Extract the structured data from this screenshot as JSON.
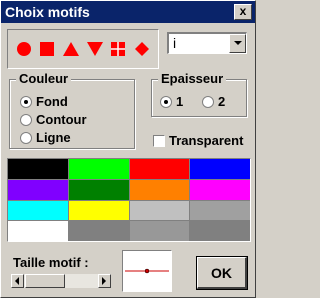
{
  "window": {
    "title": "Choix motifs",
    "close_label": "x"
  },
  "shapes": [
    {
      "name": "circle-shape-icon",
      "shape": "circle"
    },
    {
      "name": "square-shape-icon",
      "shape": "square"
    },
    {
      "name": "triangle-up-shape-icon",
      "shape": "triangle-up"
    },
    {
      "name": "triangle-down-shape-icon",
      "shape": "triangle-down"
    },
    {
      "name": "cross-square-shape-icon",
      "shape": "cross-square"
    },
    {
      "name": "diamond-shape-icon",
      "shape": "diamond"
    }
  ],
  "shape_color": "#ff0000",
  "combo": {
    "value": "i"
  },
  "couleur": {
    "title": "Couleur",
    "options": [
      {
        "label": "Fond",
        "checked": true
      },
      {
        "label": "Contour",
        "checked": false
      },
      {
        "label": "Ligne",
        "checked": false
      }
    ]
  },
  "epaisseur": {
    "title": "Epaisseur",
    "options": [
      {
        "label": "1",
        "checked": true
      },
      {
        "label": "2",
        "checked": false
      }
    ]
  },
  "transparent": {
    "label": "Transparent",
    "checked": false
  },
  "palette": [
    "#000000",
    "#00ff00",
    "#ff0000",
    "#0000ff",
    "#8000ff",
    "#008000",
    "#ff8000",
    "#ff00ff",
    "#00ffff",
    "#ffff00",
    "#c0c0c0",
    "#a0a0a0",
    "#ffffff",
    "#808080",
    "#989898",
    "#808080"
  ],
  "size": {
    "label": "Taille motif :"
  },
  "ok_label": "OK"
}
